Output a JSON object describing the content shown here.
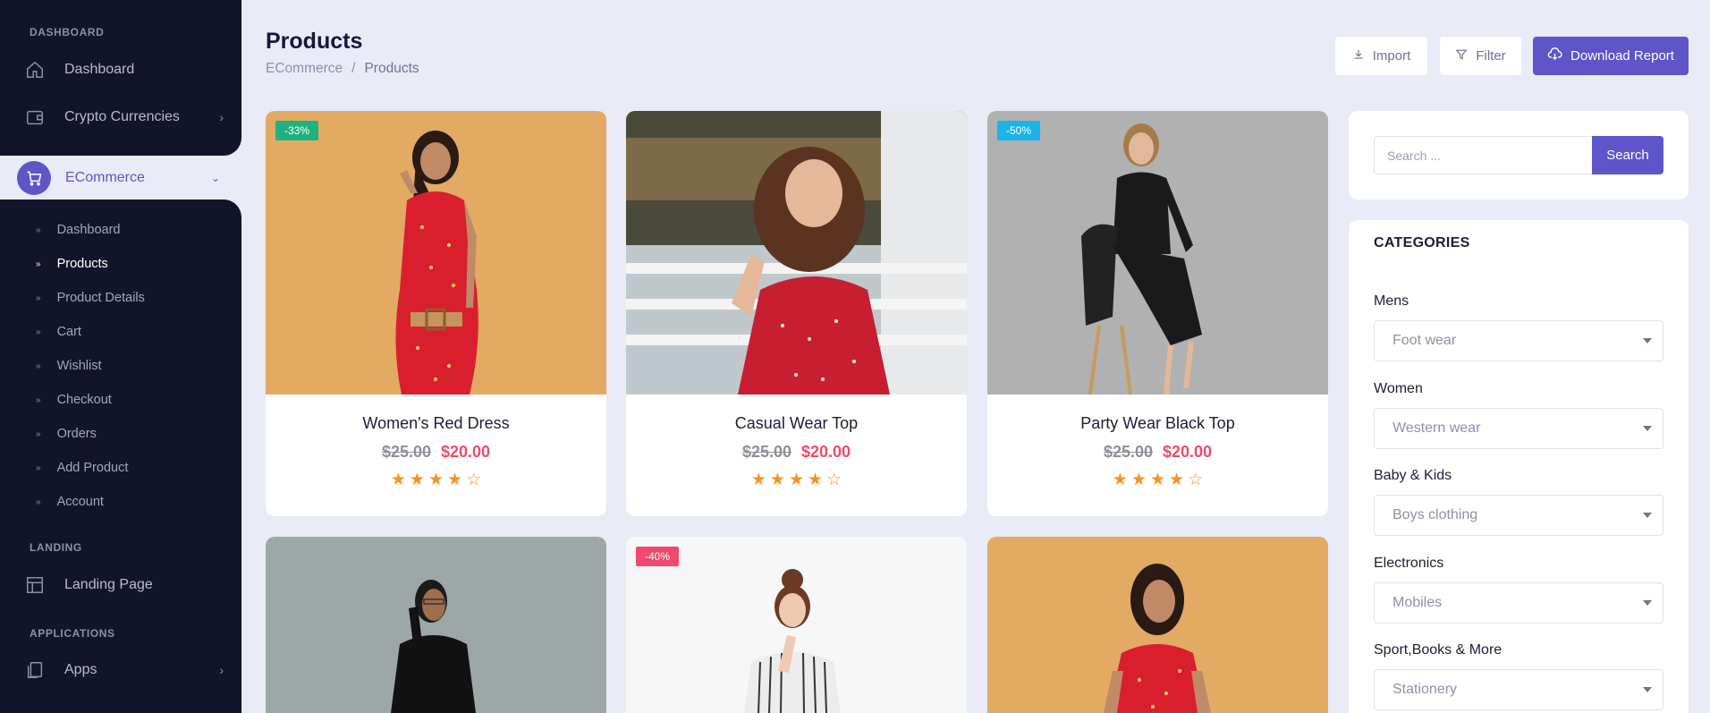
{
  "sidebar": {
    "sections": {
      "dashboard": "DASHBOARD",
      "landing": "LANDING",
      "applications": "APPLICATIONS"
    },
    "items": [
      {
        "label": "Dashboard",
        "icon": "home-icon"
      },
      {
        "label": "Crypto Currencies",
        "icon": "wallet-icon"
      },
      {
        "label": "ECommerce",
        "icon": "shopping-cart-icon"
      },
      {
        "label": "Landing Page",
        "icon": "layout-icon"
      },
      {
        "label": "Apps",
        "icon": "copy-icon"
      }
    ],
    "ecommerce_sub": [
      {
        "label": "Dashboard"
      },
      {
        "label": "Products",
        "active": true
      },
      {
        "label": "Product Details"
      },
      {
        "label": "Cart"
      },
      {
        "label": "Wishlist"
      },
      {
        "label": "Checkout"
      },
      {
        "label": "Orders"
      },
      {
        "label": "Add Product"
      },
      {
        "label": "Account"
      }
    ]
  },
  "header": {
    "title": "Products",
    "breadcrumb": [
      "ECommerce",
      "/",
      "Products"
    ],
    "buttons": {
      "import": "Import",
      "filter": "Filter",
      "download": "Download Report"
    }
  },
  "products": [
    {
      "name": "Women's Red Dress",
      "old_price": "$25.00",
      "price": "$20.00",
      "badge": "-33%",
      "badge_color": "#1fb27e",
      "rating": 4,
      "bg": "#e2aa63"
    },
    {
      "name": "Casual Wear Top",
      "old_price": "$25.00",
      "price": "$20.00",
      "badge": "",
      "rating": 4,
      "bg": "#bfc9cc"
    },
    {
      "name": "Party Wear Black Top",
      "old_price": "$25.00",
      "price": "$20.00",
      "badge": "-50%",
      "badge_color": "#1ab4e8",
      "rating": 4,
      "bg": "#b1b1b1"
    },
    {
      "name": "",
      "badge": "",
      "bg": "#9ea7a8"
    },
    {
      "name": "",
      "badge": "-40%",
      "badge_color": "#ef4a6b",
      "bg": "#f7f7f7"
    },
    {
      "name": "",
      "badge": "",
      "bg": "#e2aa63"
    }
  ],
  "search": {
    "placeholder": "Search ...",
    "button": "Search"
  },
  "categories": {
    "title": "CATEGORIES",
    "groups": [
      {
        "label": "Mens",
        "selected": "Foot wear"
      },
      {
        "label": "Women",
        "selected": "Western wear"
      },
      {
        "label": "Baby & Kids",
        "selected": "Boys clothing"
      },
      {
        "label": "Electronics",
        "selected": "Mobiles"
      },
      {
        "label": "Sport,Books & More",
        "selected": "Stationery"
      }
    ]
  },
  "colors": {
    "primary": "#5d55c8",
    "sidebar": "#12142b",
    "background": "#e9ebf6",
    "sale": "#ef4a6b",
    "star": "#f7931e"
  }
}
